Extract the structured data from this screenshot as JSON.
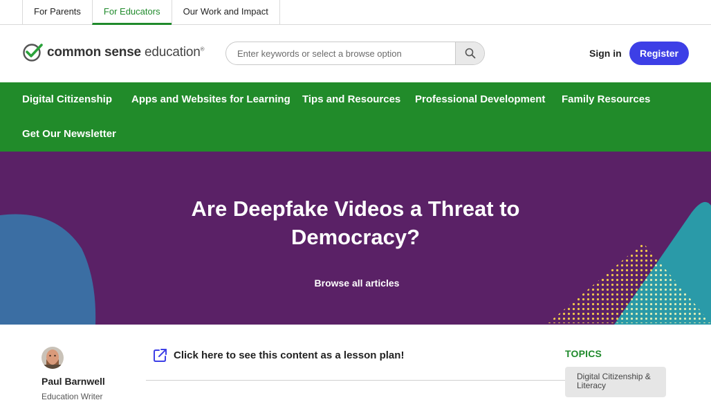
{
  "audience_tabs": [
    {
      "label": "For Parents",
      "active": false
    },
    {
      "label": "For Educators",
      "active": true
    },
    {
      "label": "Our Work and Impact",
      "active": false
    }
  ],
  "logo": {
    "brand": "common sense",
    "product": "education",
    "mark": "checkmark-circle-icon",
    "reg": "®"
  },
  "search": {
    "placeholder": "Enter keywords or select a browse option",
    "icon": "search-icon"
  },
  "auth": {
    "signin": "Sign in",
    "register": "Register"
  },
  "nav": [
    "Digital Citizenship",
    "Apps and Websites for Learning",
    "Tips and Resources",
    "Professional Development",
    "Family Resources",
    "Get Our Newsletter"
  ],
  "hero": {
    "title": "Are Deepfake Videos a Threat to Democracy?",
    "browse_link": "Browse all articles"
  },
  "author": {
    "name": "Paul Barnwell",
    "role": "Education Writer"
  },
  "lesson_link": {
    "label": "Click here to see this content as a lesson plan!",
    "icon": "external-link-icon"
  },
  "topics": {
    "heading": "TOPICS",
    "items": [
      "Digital Citizenship & Literacy"
    ]
  },
  "colors": {
    "brand_green": "#218b2a",
    "hero_purple": "#5a2166",
    "register_blue": "#3d3fe6",
    "teal": "#2a9aa8",
    "blue_blob": "#3b6ea3",
    "dots_yellow": "#f2c84b"
  }
}
